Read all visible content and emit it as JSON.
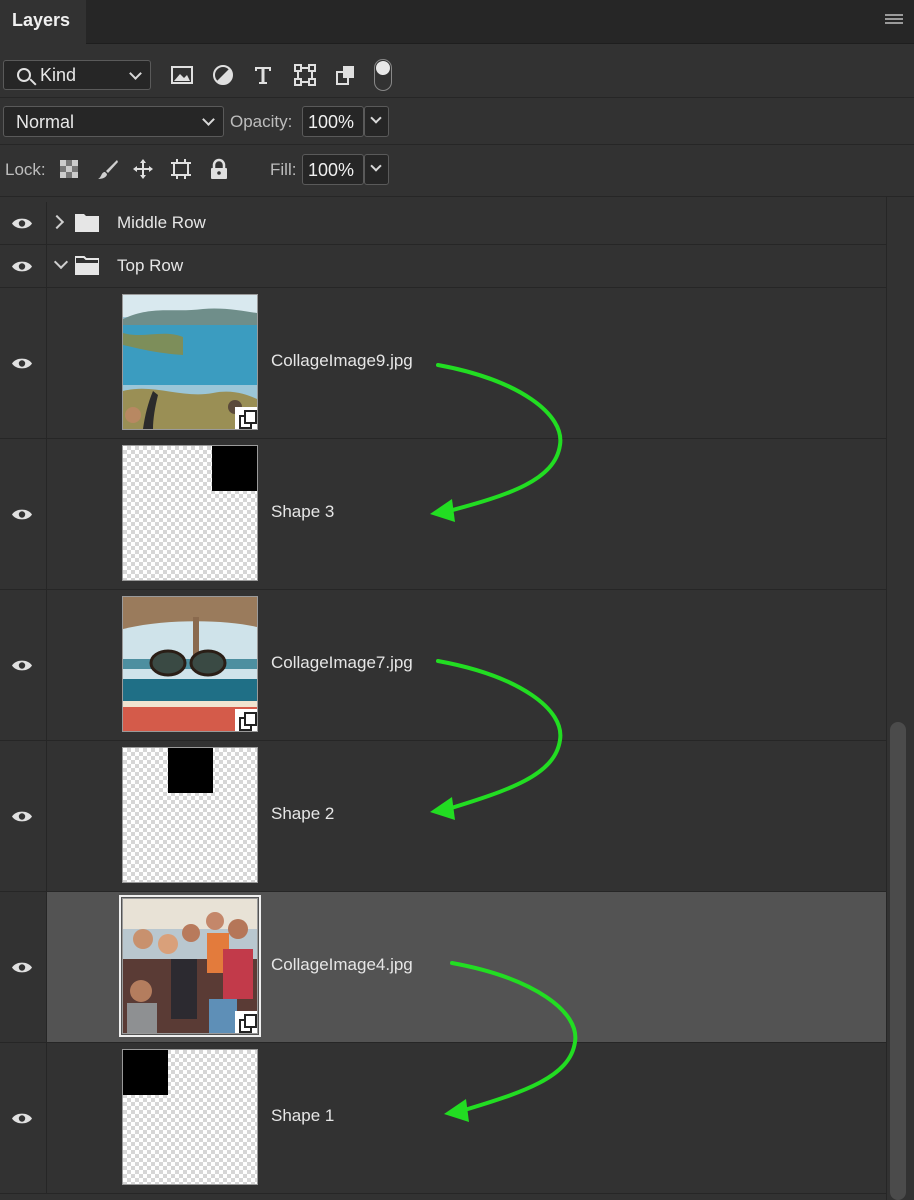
{
  "panel": {
    "tab_title": "Layers"
  },
  "filter": {
    "kind_label": "Kind",
    "icons": [
      "image-filter-icon",
      "adjustment-filter-icon",
      "type-filter-icon",
      "shape-filter-icon",
      "smart-object-filter-icon"
    ]
  },
  "blend": {
    "mode": "Normal",
    "opacity_label": "Opacity:",
    "opacity_value": "100%"
  },
  "lock": {
    "label": "Lock:",
    "fill_label": "Fill:",
    "fill_value": "100%"
  },
  "layers": [
    {
      "name": "Middle Row",
      "type": "group",
      "expanded": false,
      "visible": true
    },
    {
      "name": "Top Row",
      "type": "group",
      "expanded": true,
      "visible": true
    },
    {
      "name": "CollageImage9.jpg",
      "type": "smart-object",
      "visible": true,
      "selected": false
    },
    {
      "name": "Shape 3",
      "type": "shape",
      "visible": true,
      "selected": false
    },
    {
      "name": "CollageImage7.jpg",
      "type": "smart-object",
      "visible": true,
      "selected": false
    },
    {
      "name": "Shape 2",
      "type": "shape",
      "visible": true,
      "selected": false
    },
    {
      "name": "CollageImage4.jpg",
      "type": "smart-object",
      "visible": true,
      "selected": true
    },
    {
      "name": "Shape 1",
      "type": "shape",
      "visible": true,
      "selected": false
    }
  ],
  "colors": {
    "panel_bg": "#323232",
    "selected_row": "#535353",
    "annotation_arrow": "#22dd22"
  }
}
